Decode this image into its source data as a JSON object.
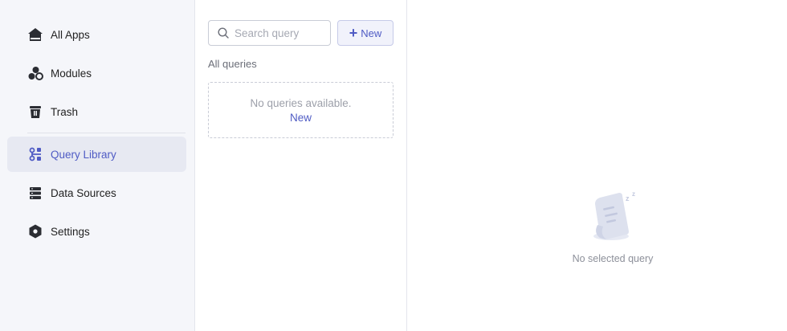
{
  "sidebar": {
    "items": [
      {
        "label": "All Apps",
        "icon": "home-icon",
        "active": false
      },
      {
        "label": "Modules",
        "icon": "modules-icon",
        "active": false
      },
      {
        "label": "Trash",
        "icon": "trash-icon",
        "active": false
      },
      {
        "label": "Query Library",
        "icon": "query-library-icon",
        "active": true
      },
      {
        "label": "Data Sources",
        "icon": "database-icon",
        "active": false
      },
      {
        "label": "Settings",
        "icon": "settings-icon",
        "active": false
      }
    ]
  },
  "query_list": {
    "search_placeholder": "Search query",
    "new_button_label": "New",
    "section_title": "All queries",
    "empty_text": "No queries available.",
    "empty_link": "New"
  },
  "detail": {
    "empty_label": "No selected query"
  },
  "colors": {
    "accent": "#4f5bc4",
    "sidebar_bg": "#f5f6fa",
    "active_bg": "#e7e9f2"
  }
}
